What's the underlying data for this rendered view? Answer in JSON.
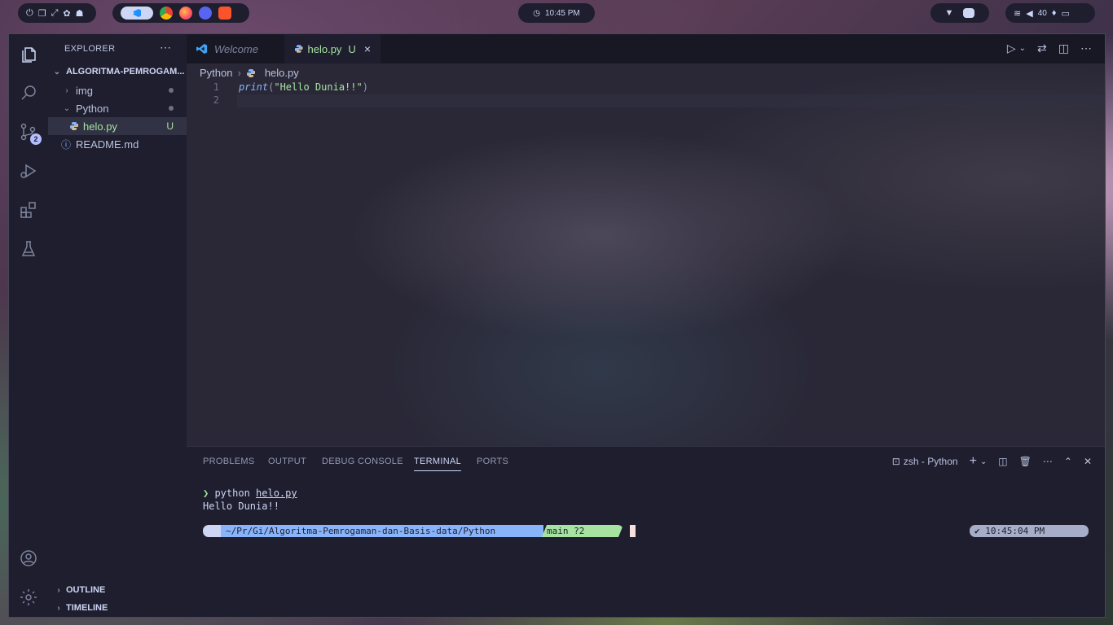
{
  "topbar": {
    "clock": "10:45 PM",
    "volume": "40"
  },
  "sidebar": {
    "title": "EXPLORER",
    "root": "ALGORITMA-PEMROGAM...",
    "items": [
      {
        "label": "img",
        "type": "folder",
        "expanded": false
      },
      {
        "label": "Python",
        "type": "folder",
        "expanded": true
      },
      {
        "label": "helo.py",
        "type": "file",
        "status": "U"
      },
      {
        "label": "README.md",
        "type": "file"
      }
    ],
    "outline": "OUTLINE",
    "timeline": "TIMELINE",
    "scm_badge": "2"
  },
  "tabs": [
    {
      "label": "Welcome",
      "active": false
    },
    {
      "label": "helo.py",
      "active": true,
      "status": "U"
    }
  ],
  "breadcrumb": [
    "Python",
    "helo.py"
  ],
  "editor": {
    "lines": [
      {
        "num": "1",
        "fn": "print",
        "open": "(",
        "str": "\"Hello Dunia!!\"",
        "close": ")"
      },
      {
        "num": "2"
      }
    ]
  },
  "panel": {
    "tabs": [
      "PROBLEMS",
      "OUTPUT",
      "DEBUG CONSOLE",
      "TERMINAL",
      "PORTS"
    ],
    "active_tab": "TERMINAL",
    "terminal_name": "zsh - Python",
    "command_prefix": "python ",
    "command_file": "helo.py",
    "output": "Hello Dunia!!",
    "prompt_icon": "",
    "prompt_path": "  ~/Pr/Gi/Algoritma-Pemrogaman-dan-Basis-data/Python",
    "prompt_git": "  main ?2",
    "prompt_right": "✔  10:45:04 PM "
  },
  "colors": {
    "accent_green": "#a6e3a1",
    "accent_blue": "#89b4fa",
    "bg": "#1e1e2e"
  }
}
